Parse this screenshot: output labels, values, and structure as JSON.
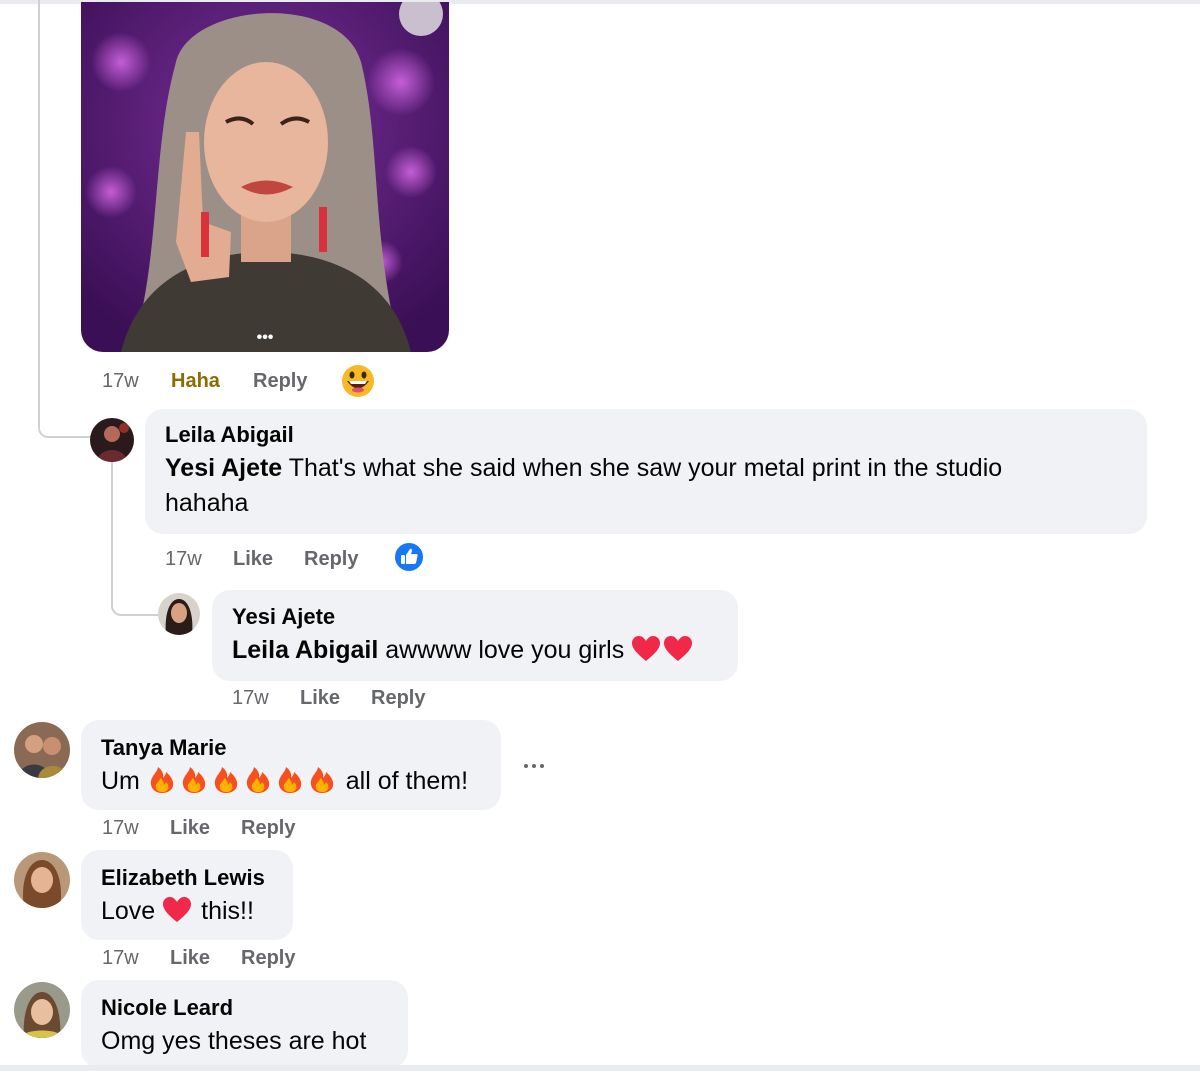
{
  "gif": {
    "indicator": "•••"
  },
  "comments": [
    {
      "id": "gif-reply",
      "time": "17w",
      "reaction_label": "Haha",
      "reply_label": "Reply",
      "reaction_icon": "haha-emoji-icon"
    },
    {
      "id": "leila",
      "author": "Leila Abigail",
      "mention": "Yesi Ajete",
      "text_line1": " That's what she said when she saw your metal print in the studio",
      "text_line2": "hahaha",
      "time": "17w",
      "like_label": "Like",
      "reply_label": "Reply",
      "reaction_icon": "like-thumb-icon"
    },
    {
      "id": "yesi",
      "author": "Yesi Ajete",
      "mention": "Leila Abigail",
      "text": " awwww love you girls ",
      "emojis": [
        "heart-emoji-icon",
        "heart-emoji-icon"
      ],
      "time": "17w",
      "like_label": "Like",
      "reply_label": "Reply"
    },
    {
      "id": "tanya",
      "author": "Tanya Marie",
      "text_before": "Um ",
      "emojis": [
        "fire-emoji-icon",
        "fire-emoji-icon",
        "fire-emoji-icon",
        "fire-emoji-icon",
        "fire-emoji-icon",
        "fire-emoji-icon"
      ],
      "text_after": " all of them!",
      "time": "17w",
      "like_label": "Like",
      "reply_label": "Reply",
      "more_icon": "more-options-icon"
    },
    {
      "id": "elizabeth",
      "author": "Elizabeth Lewis",
      "text_before": "Love ",
      "emojis": [
        "heart-emoji-icon"
      ],
      "text_after": " this!!",
      "time": "17w",
      "like_label": "Like",
      "reply_label": "Reply"
    },
    {
      "id": "nicole",
      "author": "Nicole Leard",
      "text": "Omg yes theses are hot"
    }
  ],
  "colors": {
    "bubble": "#f0f2f5",
    "meta_text": "#65676b",
    "haha_active": "#8b6d02",
    "like_blue": "#1877f2",
    "heart_red": "#f02849",
    "thread_line": "#ced0d4"
  }
}
